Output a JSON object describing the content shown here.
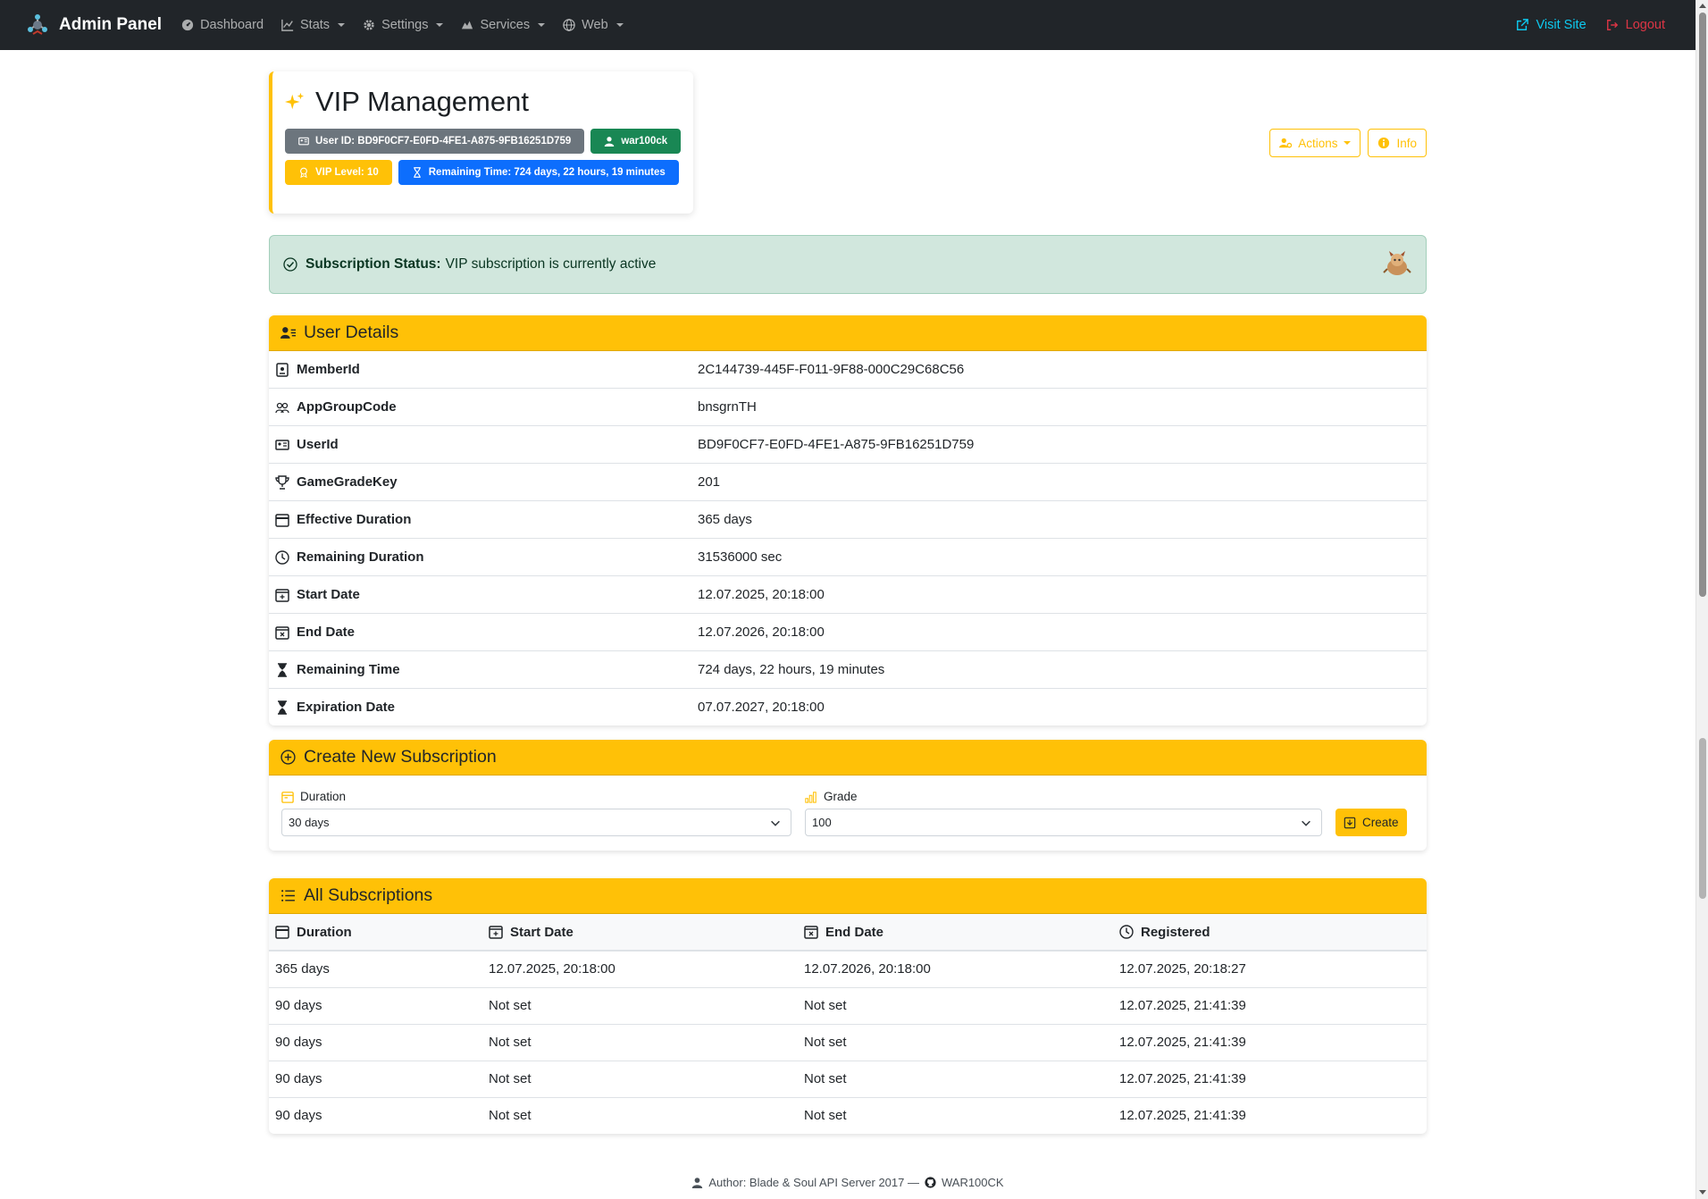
{
  "navbar": {
    "brand": "Admin Panel",
    "items": [
      {
        "label": "Dashboard",
        "dropdown": false,
        "icon": "dashboard-icon"
      },
      {
        "label": "Stats",
        "dropdown": true,
        "icon": "chart-icon"
      },
      {
        "label": "Settings",
        "dropdown": true,
        "icon": "gear-icon"
      },
      {
        "label": "Services",
        "dropdown": true,
        "icon": "services-icon"
      },
      {
        "label": "Web",
        "dropdown": true,
        "icon": "globe-icon"
      }
    ],
    "visit_site": "Visit Site",
    "logout": "Logout"
  },
  "header": {
    "title": "VIP Management",
    "badges": {
      "user_id": "User ID: BD9F0CF7-E0FD-4FE1-A875-9FB16251D759",
      "username": "war100ck",
      "vip_level": "VIP Level: 10",
      "remaining": "Remaining Time: 724 days, 22 hours, 19 minutes"
    },
    "actions_label": "Actions",
    "info_label": "Info"
  },
  "alert": {
    "label": "Subscription Status:",
    "text": "VIP subscription is currently active"
  },
  "user_details": {
    "title": "User Details",
    "rows": [
      {
        "key": "MemberId",
        "value": "2C144739-445F-F011-9F88-000C29C68C56",
        "icon": "id-badge-icon"
      },
      {
        "key": "AppGroupCode",
        "value": "bnsgrnTH",
        "icon": "people-icon"
      },
      {
        "key": "UserId",
        "value": "BD9F0CF7-E0FD-4FE1-A875-9FB16251D759",
        "icon": "id-card-icon"
      },
      {
        "key": "GameGradeKey",
        "value": "201",
        "icon": "trophy-icon"
      },
      {
        "key": "Effective Duration",
        "value": "365 days",
        "icon": "calendar-icon"
      },
      {
        "key": "Remaining Duration",
        "value": "31536000 sec",
        "icon": "clock-icon"
      },
      {
        "key": "Start Date",
        "value": "12.07.2025, 20:18:00",
        "icon": "calendar-plus-icon"
      },
      {
        "key": "End Date",
        "value": "12.07.2026, 20:18:00",
        "icon": "calendar-x-icon"
      },
      {
        "key": "Remaining Time",
        "value": "724 days, 22 hours, 19 minutes",
        "icon": "hourglass-icon"
      },
      {
        "key": "Expiration Date",
        "value": "07.07.2027, 20:18:00",
        "icon": "hourglass-icon"
      }
    ]
  },
  "create": {
    "title": "Create New Subscription",
    "duration_label": "Duration",
    "duration_value": "30 days",
    "grade_label": "Grade",
    "grade_value": "100",
    "button": "Create"
  },
  "subscriptions": {
    "title": "All Subscriptions",
    "columns": [
      "Duration",
      "Start Date",
      "End Date",
      "Registered"
    ],
    "rows": [
      [
        "365 days",
        "12.07.2025, 20:18:00",
        "12.07.2026, 20:18:00",
        "12.07.2025, 20:18:27"
      ],
      [
        "90 days",
        "Not set",
        "Not set",
        "12.07.2025, 21:41:39"
      ],
      [
        "90 days",
        "Not set",
        "Not set",
        "12.07.2025, 21:41:39"
      ],
      [
        "90 days",
        "Not set",
        "Not set",
        "12.07.2025, 21:41:39"
      ],
      [
        "90 days",
        "Not set",
        "Not set",
        "12.07.2025, 21:41:39"
      ]
    ]
  },
  "footer": {
    "author": "Author: Blade & Soul API Server 2017 —",
    "github": "WAR100CK"
  },
  "colors": {
    "accent": "#ffc107",
    "navbar": "#212529",
    "success_bg": "#d1e7dd",
    "info": "#0dcaf0",
    "danger": "#dc3545"
  }
}
